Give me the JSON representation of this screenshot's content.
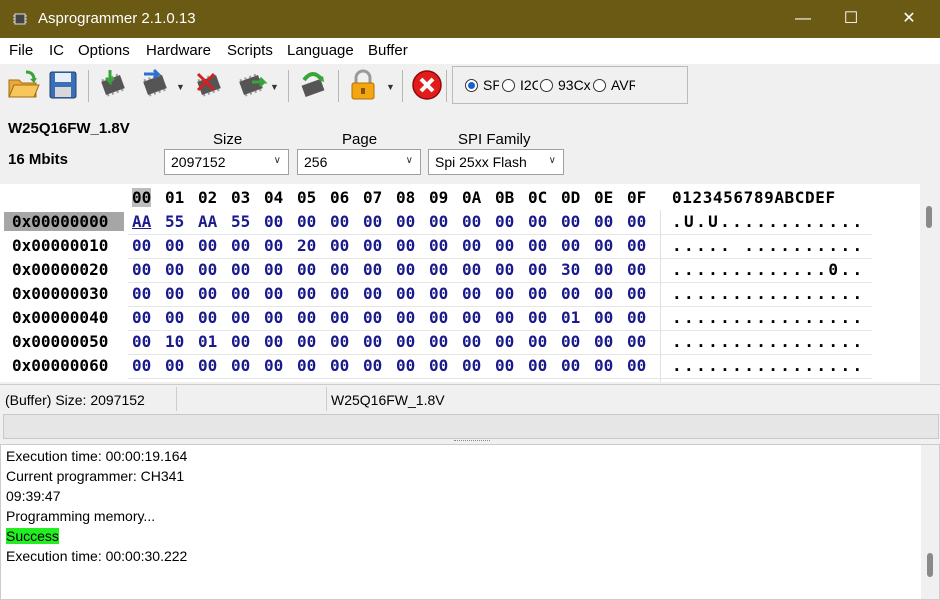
{
  "window": {
    "title": "Asprogrammer 2.1.0.13",
    "minimize": "—",
    "maximize": "☐",
    "close": "✕"
  },
  "menu": [
    "File",
    "IC",
    "Options",
    "Hardware",
    "Scripts",
    "Language",
    "Buffer"
  ],
  "toolbar": {
    "icons": [
      "open-file-icon",
      "save-icon",
      "read-chip-icon",
      "write-chip-icon",
      "erase-chip-icon",
      "verify-chip-icon",
      "check-blank-icon",
      "lock-icon",
      "stop-icon"
    ],
    "protocols": [
      {
        "label": "SPI",
        "selected": true
      },
      {
        "label": "I2C",
        "selected": false
      },
      {
        "label": "93Cx",
        "selected": false
      },
      {
        "label": "AVR",
        "selected": false
      }
    ],
    "colors": {
      "stop": "#e41b1b",
      "chip_green": "#3aa33a",
      "chip_blue": "#2c6fd0"
    }
  },
  "chip": {
    "name": "W25Q16FW_1.8V",
    "size_text": "16 Mbits"
  },
  "fields": {
    "size": {
      "label": "Size",
      "value": "2097152"
    },
    "page": {
      "label": "Page",
      "value": "256"
    },
    "family": {
      "label": "SPI Family",
      "value": "Spi 25xx Flash"
    }
  },
  "hex": {
    "columns": [
      "00",
      "01",
      "02",
      "03",
      "04",
      "05",
      "06",
      "07",
      "08",
      "09",
      "0A",
      "0B",
      "0C",
      "0D",
      "0E",
      "0F"
    ],
    "ascii_header": "0123456789ABCDEF",
    "rows": [
      {
        "addr": "0x00000000",
        "bytes": [
          "AA",
          "55",
          "AA",
          "55",
          "00",
          "00",
          "00",
          "00",
          "00",
          "00",
          "00",
          "00",
          "00",
          "00",
          "00",
          "00"
        ],
        "ascii": ".U.U............"
      },
      {
        "addr": "0x00000010",
        "bytes": [
          "00",
          "00",
          "00",
          "00",
          "00",
          "20",
          "00",
          "00",
          "00",
          "00",
          "00",
          "00",
          "00",
          "00",
          "00",
          "00"
        ],
        "ascii": "..... .........."
      },
      {
        "addr": "0x00000020",
        "bytes": [
          "00",
          "00",
          "00",
          "00",
          "00",
          "00",
          "00",
          "00",
          "00",
          "00",
          "00",
          "00",
          "00",
          "30",
          "00",
          "00"
        ],
        "ascii": ".............0.."
      },
      {
        "addr": "0x00000030",
        "bytes": [
          "00",
          "00",
          "00",
          "00",
          "00",
          "00",
          "00",
          "00",
          "00",
          "00",
          "00",
          "00",
          "00",
          "00",
          "00",
          "00"
        ],
        "ascii": "................"
      },
      {
        "addr": "0x00000040",
        "bytes": [
          "00",
          "00",
          "00",
          "00",
          "00",
          "00",
          "00",
          "00",
          "00",
          "00",
          "00",
          "00",
          "00",
          "01",
          "00",
          "00"
        ],
        "ascii": "................"
      },
      {
        "addr": "0x00000050",
        "bytes": [
          "00",
          "10",
          "01",
          "00",
          "00",
          "00",
          "00",
          "00",
          "00",
          "00",
          "00",
          "00",
          "00",
          "00",
          "00",
          "00"
        ],
        "ascii": "................"
      },
      {
        "addr": "0x00000060",
        "bytes": [
          "00",
          "00",
          "00",
          "00",
          "00",
          "00",
          "00",
          "00",
          "00",
          "00",
          "00",
          "00",
          "00",
          "00",
          "00",
          "00"
        ],
        "ascii": "................"
      }
    ]
  },
  "status": {
    "buffer_size": "(Buffer) Size: 2097152",
    "middle": "",
    "chip": "W25Q16FW_1.8V"
  },
  "log": [
    {
      "text": "Execution time: 00:00:19.164",
      "highlight": false
    },
    {
      "text": "Current programmer: CH341",
      "highlight": false
    },
    {
      "text": "09:39:47",
      "highlight": false
    },
    {
      "text": "Programming memory...",
      "highlight": false
    },
    {
      "text": "Success",
      "highlight": true
    },
    {
      "text": "Execution time: 00:00:30.222",
      "highlight": false
    }
  ]
}
